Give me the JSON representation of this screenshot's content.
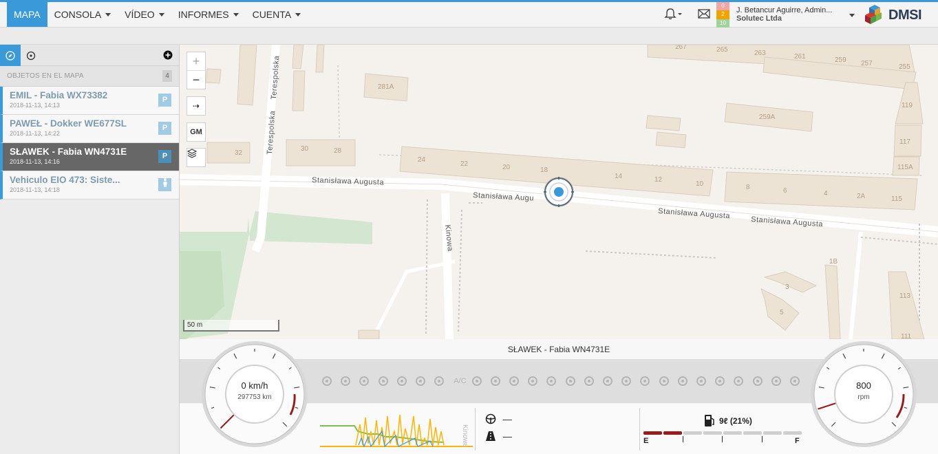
{
  "nav": {
    "items": [
      {
        "label": "MAPA",
        "active": true,
        "dropdown": false
      },
      {
        "label": "CONSOLA",
        "active": false,
        "dropdown": true
      },
      {
        "label": "VÍDEO",
        "active": false,
        "dropdown": true
      },
      {
        "label": "INFORMES",
        "active": false,
        "dropdown": true
      },
      {
        "label": "CUENTA",
        "active": false,
        "dropdown": true
      }
    ]
  },
  "header": {
    "notifications_icon": "bell-icon",
    "messages_icon": "envelope-icon",
    "counters": [
      {
        "value": "0",
        "color": "#f2a6a6"
      },
      {
        "value": "2",
        "color": "#f0a400"
      },
      {
        "value": "10",
        "color": "#9ed39a"
      }
    ],
    "user_name": "J. Betancur Aguirre, Admin...",
    "organization": "Solutec Ltda",
    "logo_text": "DMSI"
  },
  "sidebar": {
    "tab_icons": [
      "compass-icon",
      "target-icon"
    ],
    "add_icon": "plus-circle-icon",
    "header": "OBJETOS EN EL MAPA",
    "count": "4",
    "objects": [
      {
        "name": "EMIL - Fabia WX73382",
        "time": "2018-11-13, 14:13",
        "badge": "P",
        "selected": false
      },
      {
        "name": "PAWEŁ - Dokker WE677SL",
        "time": "2018-11-13, 14:22",
        "badge": "P",
        "selected": false
      },
      {
        "name": "SŁAWEK - Fabia WN4731E",
        "time": "2018-11-13, 14:16",
        "badge": "P",
        "selected": true
      },
      {
        "name": "Vehiculo EIO 473: Siste...",
        "time": "2018-11-13, 14:18",
        "badge": "person-icon",
        "selected": false
      }
    ]
  },
  "map": {
    "controls": {
      "zoom_in": "+",
      "zoom_out": "−",
      "route": "⇢",
      "gm": "GM",
      "layers_icon": "layers-icon"
    },
    "scale": "50 m",
    "streets": [
      "Stanisława Augusta",
      "Stanisława Augu",
      "Stanisława Augusta",
      "Stanisława Augusta",
      "Terespolska",
      "Terespolska",
      "Kinowa"
    ],
    "buildings": [
      "267",
      "265",
      "263",
      "261",
      "259",
      "257",
      "255",
      "281A",
      "259A",
      "119",
      "117",
      "115A",
      "32",
      "30",
      "28",
      "24",
      "22",
      "20",
      "18",
      "14",
      "12",
      "10",
      "8",
      "6",
      "4",
      "2A",
      "115",
      "1B",
      "3",
      "5",
      "113",
      "111"
    ]
  },
  "dashboard": {
    "vehicle": "SŁAWEK - Fabia WN4731E",
    "speed": "0 km/h",
    "odometer": "297753 km",
    "speed_fraction": 0,
    "rpm": "800",
    "rpm_unit": "rpm",
    "rpm_fraction": 0.1,
    "indicator_icons": [
      "fuel-pump-icon",
      "seat-icon",
      "warning-triangle-icon",
      "speedometer-icon",
      "beacon-icon",
      "lock-icon",
      "brake-icon",
      "ac-icon",
      "high-beam-icon",
      "fog-light-icon",
      "parking-light-icon",
      "rear-fog-icon",
      "seatbelt-icon",
      "car-door-icon",
      "car-open-icon",
      "abs-icon",
      "brake-circle-icon",
      "coolant-icon",
      "cloud-icon",
      "tire-icon",
      "wiper-icon",
      "tools-icon",
      "engine-icon",
      "oil-icon",
      "car-icon",
      "battery-icon"
    ],
    "ac_text": "A/C",
    "steering_icon": "steering-wheel-icon",
    "steering_value": "—",
    "road_icon": "road-icon",
    "road_value": "—",
    "fuel_icon": "fuel-pump-icon",
    "fuel_text": "9ℓ (21%)",
    "fuel_fraction": 0.21,
    "fuel_scale": {
      "empty": "E",
      "full": "F"
    },
    "chart_side_label": "Kinowa"
  }
}
